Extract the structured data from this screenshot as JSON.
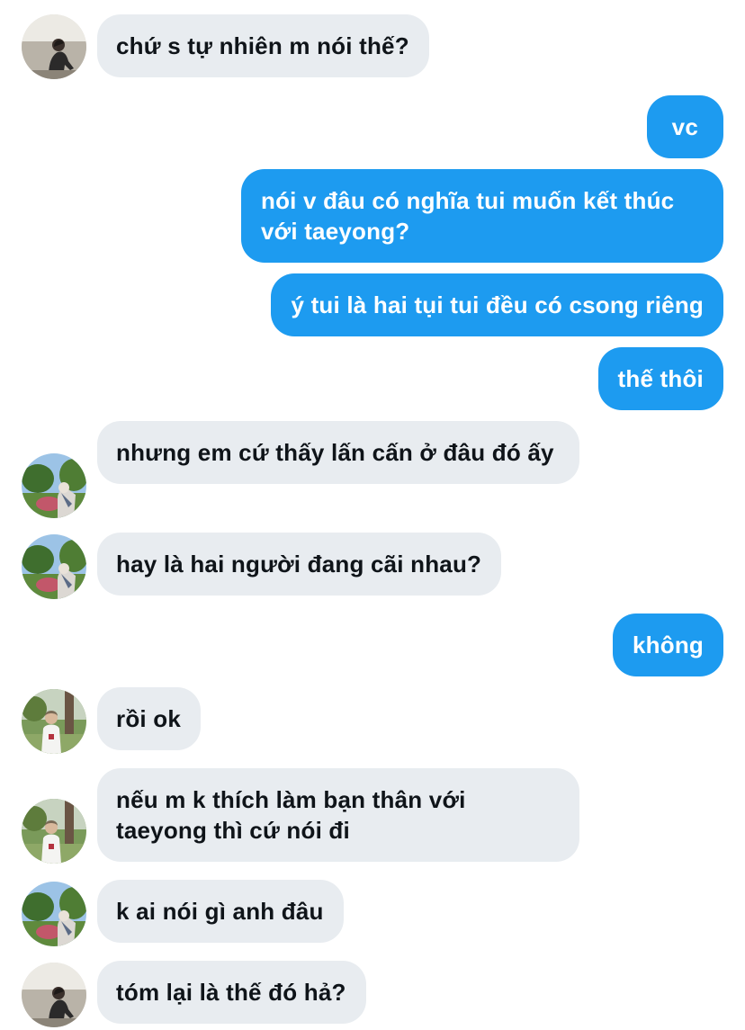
{
  "colors": {
    "incoming_bubble": "#e8ecf0",
    "outgoing_bubble": "#1d9bf0",
    "incoming_text": "#0f1419",
    "outgoing_text": "#ffffff"
  },
  "messages": [
    {
      "id": 1,
      "direction": "incoming",
      "avatar": "avatar-person-sitting",
      "text": "chứ s tự nhiên m nói thế?"
    },
    {
      "id": 2,
      "direction": "outgoing",
      "text": "vc"
    },
    {
      "id": 3,
      "direction": "outgoing",
      "text": "nói v đâu có nghĩa tui muốn kết thúc với taeyong?"
    },
    {
      "id": 4,
      "direction": "outgoing",
      "text": "ý tui là hai tụi tui đều có csong riêng"
    },
    {
      "id": 5,
      "direction": "outgoing",
      "text": "thế thôi"
    },
    {
      "id": 6,
      "direction": "incoming",
      "avatar": "avatar-person-garden",
      "text": "nhưng em cứ thấy lấn cấn ở đâu đó ấy"
    },
    {
      "id": 7,
      "direction": "incoming",
      "avatar": "avatar-person-garden",
      "text": "hay là hai người đang cãi nhau?"
    },
    {
      "id": 8,
      "direction": "outgoing",
      "text": "không"
    },
    {
      "id": 9,
      "direction": "incoming",
      "avatar": "avatar-person-park",
      "text": "rồi ok"
    },
    {
      "id": 10,
      "direction": "incoming",
      "avatar": "avatar-person-park",
      "text": "nếu m k thích làm bạn thân với taeyong thì cứ nói đi"
    },
    {
      "id": 11,
      "direction": "incoming",
      "avatar": "avatar-person-garden",
      "text": "k ai nói gì anh đâu"
    },
    {
      "id": 12,
      "direction": "incoming",
      "avatar": "avatar-person-sitting",
      "text": "tóm lại là thế đó hả?"
    }
  ]
}
